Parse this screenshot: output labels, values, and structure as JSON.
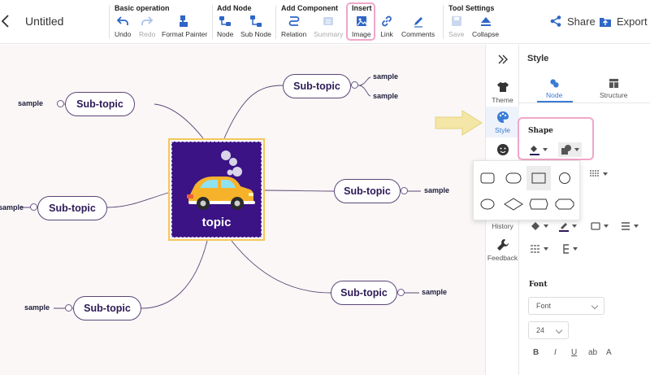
{
  "header": {
    "title": "Untitled",
    "groups": {
      "basic": "Basic operation",
      "add_node": "Add Node",
      "add_component": "Add Component",
      "insert": "Insert",
      "tool_settings": "Tool Settings"
    },
    "tools": {
      "undo": "Undo",
      "redo": "Redo",
      "format_painter": "Format Painter",
      "node": "Node",
      "sub_node": "Sub Node",
      "relation": "Relation",
      "summary": "Summary",
      "image": "Image",
      "link": "Link",
      "comments": "Comments",
      "save": "Save",
      "collapse": "Collapse"
    },
    "share": "Share",
    "export": "Export"
  },
  "canvas": {
    "topic": "topic",
    "subtopics": {
      "upper_left": "Sub-topic",
      "mid_left": "Sub-topic",
      "lower_left": "Sub-topic",
      "upper_right": "Sub-topic",
      "mid_right": "Sub-topic",
      "lower_right": "Sub-topic"
    },
    "leaves": {
      "upper_left": "sample",
      "mid_left": "sample",
      "lower_left": "sample",
      "upper_right_1": "sample",
      "upper_right_2": "sample",
      "mid_right": "sample",
      "lower_right": "sample"
    }
  },
  "sidebar": {
    "theme": "Theme",
    "style": "Style",
    "history": "History",
    "feedback": "Feedback"
  },
  "panel": {
    "title": "Style",
    "tabs": {
      "node": "Node",
      "structure": "Structure"
    },
    "shape_label": "Shape",
    "font_label": "Font",
    "font_family": "Font",
    "font_size": "24",
    "format": {
      "bold": "B",
      "italic": "I",
      "underline": "U",
      "case": "ab",
      "color": "A"
    }
  },
  "colors": {
    "accent": "#3a7bd5",
    "topic_bg": "#3b1385",
    "topic_border": "#f5c75a",
    "highlight": "#f0a6c8",
    "branch": "#5a4678"
  }
}
